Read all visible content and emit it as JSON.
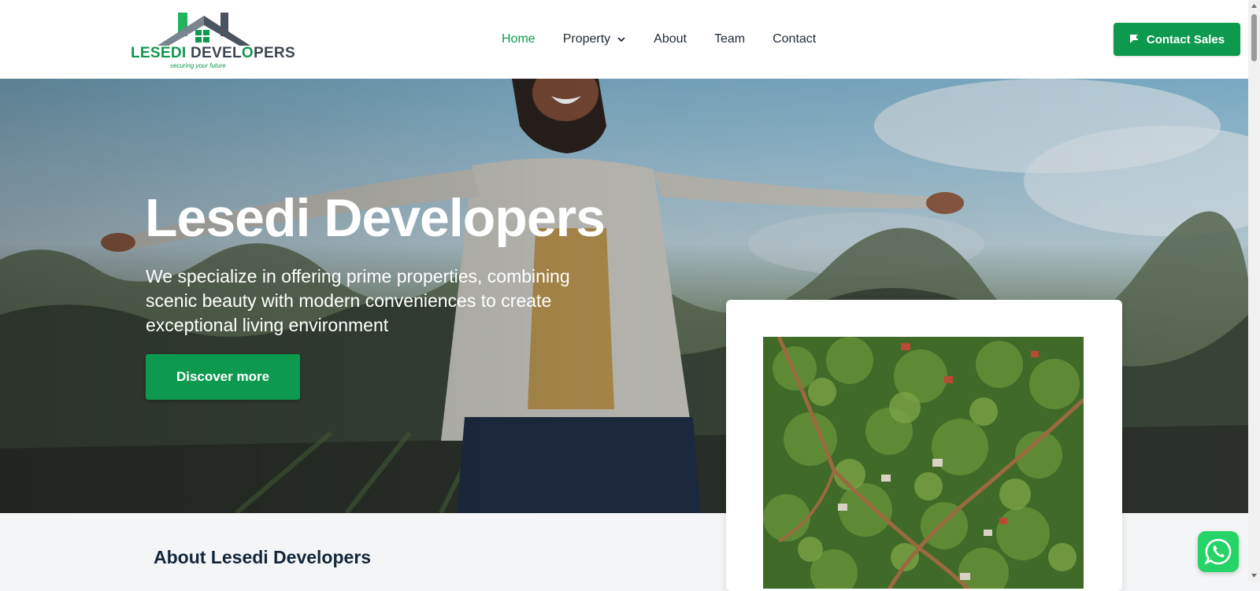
{
  "brand": {
    "name_part1": "LESEDI",
    "name_part2": "DEVEL",
    "name_part3": "O",
    "name_part4": "PERS",
    "tagline": "securing your future",
    "colors": {
      "green": "#0e9a4e",
      "dark": "#3c4551"
    }
  },
  "nav": {
    "items": [
      {
        "label": "Home",
        "active": true
      },
      {
        "label": "Property",
        "has_dropdown": true
      },
      {
        "label": "About"
      },
      {
        "label": "Team"
      },
      {
        "label": "Contact"
      }
    ]
  },
  "header": {
    "contact_button": {
      "label": "Contact Sales",
      "icon": "chat-flag-icon"
    }
  },
  "hero": {
    "title": "Lesedi Developers",
    "description": "We specialize in offering prime properties, combining scenic beauty with modern conveniences to create exceptional living environment",
    "cta_label": "Discover more"
  },
  "about": {
    "title": "About Lesedi Developers"
  },
  "floating": {
    "whatsapp_icon": "whatsapp-icon"
  }
}
